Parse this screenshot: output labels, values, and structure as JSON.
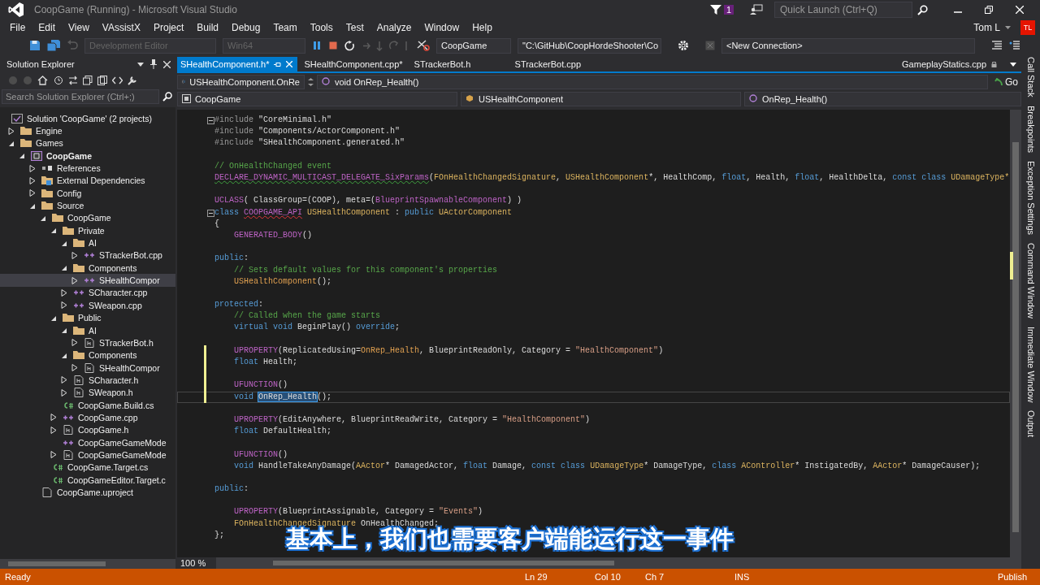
{
  "window": {
    "title": "CoopGame (Running) - Microsoft Visual Studio",
    "notification_count": "1",
    "quick_launch": {
      "placeholder": "Quick Launch (Ctrl+Q)"
    }
  },
  "menu": [
    "File",
    "Edit",
    "View",
    "VAssistX",
    "Project",
    "Build",
    "Debug",
    "Team",
    "Tools",
    "Test",
    "Analyze",
    "Window",
    "Help"
  ],
  "user": {
    "name": "Tom L",
    "initials": "TL"
  },
  "toolbar": {
    "configuration": {
      "value": "Development Editor",
      "disabled": true
    },
    "platform": {
      "value": "Win64",
      "disabled": true
    },
    "startup_project": "CoopGame",
    "command_line": "\"C:\\GitHub\\CoopHordeShooter\\Co",
    "connection": "<New Connection>"
  },
  "solution_explorer": {
    "title": "Solution Explorer",
    "search": {
      "placeholder": "Search Solution Explorer (Ctrl+;)"
    },
    "tree": [
      {
        "label": "Solution 'CoopGame' (2 projects)",
        "kind": "solution",
        "selected": false,
        "children": [
          {
            "label": "Engine",
            "kind": "folder",
            "expanded": false,
            "selected": false
          },
          {
            "label": "Games",
            "kind": "folder",
            "expanded": true,
            "selected": false,
            "children": [
              {
                "label": "CoopGame",
                "kind": "project",
                "expanded": true,
                "selected": false,
                "children": [
                  {
                    "label": "References",
                    "kind": "references",
                    "expanded": false,
                    "selected": false
                  },
                  {
                    "label": "External Dependencies",
                    "kind": "external",
                    "expanded": false,
                    "selected": false
                  },
                  {
                    "label": "Config",
                    "kind": "folder",
                    "expanded": false,
                    "selected": false
                  },
                  {
                    "label": "Source",
                    "kind": "folder",
                    "expanded": true,
                    "selected": false,
                    "children": [
                      {
                        "label": "CoopGame",
                        "kind": "folder",
                        "expanded": true,
                        "selected": false,
                        "children": [
                          {
                            "label": "Private",
                            "kind": "folder",
                            "expanded": true,
                            "selected": false,
                            "children": [
                              {
                                "label": "AI",
                                "kind": "folder",
                                "expanded": true,
                                "selected": false,
                                "children": [
                                  {
                                    "label": "STrackerBot.cpp",
                                    "kind": "cpp",
                                    "expanded": false,
                                    "selected": false
                                  }
                                ]
                              },
                              {
                                "label": "Components",
                                "kind": "folder",
                                "expanded": true,
                                "selected": false,
                                "children": [
                                  {
                                    "label": "SHealthCompor",
                                    "kind": "cpp",
                                    "expanded": false,
                                    "selected": true
                                  }
                                ]
                              },
                              {
                                "label": "SCharacter.cpp",
                                "kind": "cpp",
                                "expanded": false,
                                "selected": false
                              },
                              {
                                "label": "SWeapon.cpp",
                                "kind": "cpp",
                                "expanded": false,
                                "selected": false
                              }
                            ]
                          },
                          {
                            "label": "Public",
                            "kind": "folder",
                            "expanded": true,
                            "selected": false,
                            "children": [
                              {
                                "label": "AI",
                                "kind": "folder",
                                "expanded": true,
                                "selected": false,
                                "children": [
                                  {
                                    "label": "STrackerBot.h",
                                    "kind": "h",
                                    "expanded": false,
                                    "selected": false
                                  }
                                ]
                              },
                              {
                                "label": "Components",
                                "kind": "folder",
                                "expanded": true,
                                "selected": false,
                                "children": [
                                  {
                                    "label": "SHealthCompor",
                                    "kind": "h",
                                    "expanded": false,
                                    "selected": false
                                  }
                                ]
                              },
                              {
                                "label": "SCharacter.h",
                                "kind": "h",
                                "expanded": false,
                                "selected": false
                              },
                              {
                                "label": "SWeapon.h",
                                "kind": "h",
                                "expanded": false,
                                "selected": false
                              }
                            ]
                          },
                          {
                            "label": "CoopGame.Build.cs",
                            "kind": "cs",
                            "selected": false
                          },
                          {
                            "label": "CoopGame.cpp",
                            "kind": "cpp",
                            "expanded": false,
                            "selected": false
                          },
                          {
                            "label": "CoopGame.h",
                            "kind": "h",
                            "expanded": false,
                            "selected": false
                          },
                          {
                            "label": "CoopGameGameMode",
                            "kind": "cpp",
                            "selected": false
                          },
                          {
                            "label": "CoopGameGameMode",
                            "kind": "h",
                            "expanded": false,
                            "selected": false
                          }
                        ]
                      },
                      {
                        "label": "CoopGame.Target.cs",
                        "kind": "cs",
                        "selected": false
                      },
                      {
                        "label": "CoopGameEditor.Target.c",
                        "kind": "cs",
                        "selected": false
                      }
                    ]
                  },
                  {
                    "label": "CoopGame.uproject",
                    "kind": "file",
                    "selected": false
                  }
                ]
              }
            ]
          }
        ]
      }
    ]
  },
  "editor": {
    "tabs": [
      {
        "label": "SHealthComponent.h*",
        "kind": "normal",
        "selected": true
      },
      {
        "label": "SHealthComponent.cpp*",
        "kind": "normal",
        "selected": false
      },
      {
        "label": "STrackerBot.h",
        "kind": "normal",
        "selected": false
      },
      {
        "label": "STrackerBot.cpp",
        "kind": "normal",
        "selected": false
      },
      {
        "label": "GameplayStatics.cpp",
        "kind": "preview",
        "selected": false
      }
    ],
    "navigation": {
      "scope": "USHealthComponent.OnRe",
      "member": "void OnRep_Health()",
      "go": "Go"
    },
    "context": {
      "project": "CoopGame",
      "class": "USHealthComponent",
      "function": "OnRep_Health()"
    },
    "lines": [
      {
        "segments": [
          {
            "text": "#include",
            "kind": "preproc"
          },
          {
            "text": " \"CoreMinimal.h\"",
            "kind": "plain"
          }
        ],
        "fold": true,
        "changed": false,
        "current": false
      },
      {
        "segments": [
          {
            "text": "#include",
            "kind": "preproc"
          },
          {
            "text": " \"Components/ActorComponent.h\"",
            "kind": "plain"
          }
        ],
        "fold": false,
        "changed": false,
        "current": false
      },
      {
        "segments": [
          {
            "text": "#include",
            "kind": "preproc"
          },
          {
            "text": " \"SHealthComponent.generated.h\"",
            "kind": "plain"
          }
        ],
        "fold": false,
        "changed": false,
        "current": false
      },
      {
        "fold": false,
        "changed": false,
        "current": false
      },
      {
        "segments": [
          {
            "text": "// OnHealthChanged event",
            "kind": "comment"
          }
        ],
        "fold": false,
        "changed": false,
        "current": false
      },
      {
        "segments": [
          {
            "text": "DECLARE_DYNAMIC_MULTICAST_DELEGATE_SixParams",
            "kind": "macro_warning"
          },
          {
            "text": "(",
            "kind": "plain"
          },
          {
            "text": "FOnHealthChangedSignature",
            "kind": "type"
          },
          {
            "text": ", ",
            "kind": "plain"
          },
          {
            "text": "USHealthComponent",
            "kind": "type"
          },
          {
            "text": "*, HealthComp, ",
            "kind": "plain"
          },
          {
            "text": "float",
            "kind": "keyword"
          },
          {
            "text": ", Health, ",
            "kind": "plain"
          },
          {
            "text": "float",
            "kind": "keyword"
          },
          {
            "text": ", HealthDelta, ",
            "kind": "plain"
          },
          {
            "text": "const class ",
            "kind": "keyword"
          },
          {
            "text": "UDamageType*",
            "kind": "type"
          }
        ],
        "fold": false,
        "changed": false,
        "current": false
      },
      {
        "fold": false,
        "changed": false,
        "current": false
      },
      {
        "segments": [
          {
            "text": "UCLASS",
            "kind": "macro"
          },
          {
            "text": "( ClassGroup=(COOP), meta=(",
            "kind": "plain"
          },
          {
            "text": "BlueprintSpawnableComponent",
            "kind": "macro"
          },
          {
            "text": ") )",
            "kind": "plain"
          }
        ],
        "fold": false,
        "changed": false,
        "current": false
      },
      {
        "segments": [
          {
            "text": "class ",
            "kind": "keyword"
          },
          {
            "text": "COOPGAME_API",
            "kind": "macro_error"
          },
          {
            "text": " USHealthComponent",
            "kind": "type"
          },
          {
            "text": " : ",
            "kind": "plain"
          },
          {
            "text": "public ",
            "kind": "keyword"
          },
          {
            "text": "UActorComponent",
            "kind": "type"
          }
        ],
        "fold": true,
        "changed": false,
        "current": false
      },
      {
        "segments": [
          {
            "text": "{",
            "kind": "plain"
          }
        ],
        "fold": false,
        "changed": false,
        "current": false
      },
      {
        "segments": [
          {
            "text": "    GENERATED_BODY",
            "kind": "macro"
          },
          {
            "text": "()",
            "kind": "plain"
          }
        ],
        "fold": false,
        "changed": false,
        "current": false
      },
      {
        "fold": false,
        "changed": false,
        "current": false
      },
      {
        "segments": [
          {
            "text": "public",
            "kind": "keyword"
          },
          {
            "text": ":",
            "kind": "plain"
          }
        ],
        "fold": false,
        "changed": false,
        "current": false
      },
      {
        "segments": [
          {
            "text": "    // Sets default values for this component's properties",
            "kind": "comment"
          }
        ],
        "fold": false,
        "changed": false,
        "current": false
      },
      {
        "segments": [
          {
            "text": "    USHealthComponent",
            "kind": "function"
          },
          {
            "text": "();",
            "kind": "plain"
          }
        ],
        "fold": false,
        "changed": false,
        "current": false
      },
      {
        "fold": false,
        "changed": false,
        "current": false
      },
      {
        "segments": [
          {
            "text": "protected",
            "kind": "keyword"
          },
          {
            "text": ":",
            "kind": "plain"
          }
        ],
        "fold": false,
        "changed": false,
        "current": false
      },
      {
        "segments": [
          {
            "text": "    // Called when the game starts",
            "kind": "comment"
          }
        ],
        "fold": false,
        "changed": false,
        "current": false
      },
      {
        "segments": [
          {
            "text": "    virtual void",
            "kind": "keyword"
          },
          {
            "text": " BeginPlay() ",
            "kind": "plain"
          },
          {
            "text": "override",
            "kind": "keyword"
          },
          {
            "text": ";",
            "kind": "plain"
          }
        ],
        "fold": false,
        "changed": false,
        "current": false
      },
      {
        "fold": false,
        "changed": false,
        "current": false
      },
      {
        "segments": [
          {
            "text": "    UPROPERTY",
            "kind": "macro"
          },
          {
            "text": "(ReplicatedUsing=",
            "kind": "plain"
          },
          {
            "text": "OnRep_Health",
            "kind": "function"
          },
          {
            "text": ", BlueprintReadOnly, Category = ",
            "kind": "plain"
          },
          {
            "text": "\"HealthComponent\"",
            "kind": "string"
          },
          {
            "text": ")",
            "kind": "plain"
          }
        ],
        "fold": false,
        "changed": true,
        "current": false
      },
      {
        "segments": [
          {
            "text": "    float",
            "kind": "keyword"
          },
          {
            "text": " Health;",
            "kind": "plain"
          }
        ],
        "fold": false,
        "changed": true,
        "current": false
      },
      {
        "fold": false,
        "changed": true,
        "current": false
      },
      {
        "segments": [
          {
            "text": "    UFUNCTION",
            "kind": "macro"
          },
          {
            "text": "()",
            "kind": "plain"
          }
        ],
        "fold": false,
        "changed": true,
        "current": false
      },
      {
        "segments": [
          {
            "text": "    void ",
            "kind": "keyword"
          },
          {
            "text": "OnRep_Health",
            "kind": "highlight"
          },
          {
            "text": "();",
            "kind": "plain"
          }
        ],
        "fold": false,
        "changed": true,
        "current": true
      },
      {
        "fold": false,
        "changed": false,
        "current": false
      },
      {
        "segments": [
          {
            "text": "    UPROPERTY",
            "kind": "macro"
          },
          {
            "text": "(EditAnywhere, BlueprintReadWrite, Category = ",
            "kind": "plain"
          },
          {
            "text": "\"HealthComponent\"",
            "kind": "string"
          },
          {
            "text": ")",
            "kind": "plain"
          }
        ],
        "fold": false,
        "changed": false,
        "current": false
      },
      {
        "segments": [
          {
            "text": "    float",
            "kind": "keyword"
          },
          {
            "text": " DefaultHealth;",
            "kind": "plain"
          }
        ],
        "fold": false,
        "changed": false,
        "current": false
      },
      {
        "fold": false,
        "changed": false,
        "current": false
      },
      {
        "segments": [
          {
            "text": "    UFUNCTION",
            "kind": "macro"
          },
          {
            "text": "()",
            "kind": "plain"
          }
        ],
        "fold": false,
        "changed": false,
        "current": false
      },
      {
        "segments": [
          {
            "text": "    void",
            "kind": "keyword"
          },
          {
            "text": " HandleTakeAnyDamage(",
            "kind": "plain"
          },
          {
            "text": "AActor",
            "kind": "type"
          },
          {
            "text": "* DamagedActor, ",
            "kind": "plain"
          },
          {
            "text": "float",
            "kind": "keyword"
          },
          {
            "text": " Damage, ",
            "kind": "plain"
          },
          {
            "text": "const class ",
            "kind": "keyword"
          },
          {
            "text": "UDamageType",
            "kind": "type"
          },
          {
            "text": "* DamageType, ",
            "kind": "plain"
          },
          {
            "text": "class ",
            "kind": "keyword"
          },
          {
            "text": "AController",
            "kind": "type"
          },
          {
            "text": "* InstigatedBy, ",
            "kind": "plain"
          },
          {
            "text": "AActor",
            "kind": "type"
          },
          {
            "text": "* DamageCauser);",
            "kind": "plain"
          }
        ],
        "fold": false,
        "changed": false,
        "current": false
      },
      {
        "fold": false,
        "changed": false,
        "current": false
      },
      {
        "segments": [
          {
            "text": "public",
            "kind": "keyword"
          },
          {
            "text": ":",
            "kind": "plain"
          }
        ],
        "fold": false,
        "changed": false,
        "current": false
      },
      {
        "fold": false,
        "changed": false,
        "current": false
      },
      {
        "segments": [
          {
            "text": "    UPROPERTY",
            "kind": "macro"
          },
          {
            "text": "(BlueprintAssignable, Category = ",
            "kind": "plain"
          },
          {
            "text": "\"Events\"",
            "kind": "string"
          },
          {
            "text": ")",
            "kind": "plain"
          }
        ],
        "fold": false,
        "changed": false,
        "current": false
      },
      {
        "segments": [
          {
            "text": "    FOnHealthChangedSignature",
            "kind": "type"
          },
          {
            "text": " OnHealthChanged;",
            "kind": "plain"
          }
        ],
        "fold": false,
        "changed": false,
        "current": false
      },
      {
        "segments": [
          {
            "text": "};",
            "kind": "plain"
          }
        ],
        "fold": false,
        "changed": false,
        "current": false
      }
    ],
    "zoom": "100 %"
  },
  "tool_tabs": [
    "Call Stack",
    "Breakpoints",
    "Exception Settings",
    "Command Window",
    "Immediate Window",
    "Output"
  ],
  "subtitle": "基本上，我们也需要客户端能运行这一事件",
  "status_bar": {
    "message": "Ready",
    "line": "Ln 29",
    "column": "Col 10",
    "char": "Ch 7",
    "mode": "INS",
    "publish": "Publish"
  }
}
